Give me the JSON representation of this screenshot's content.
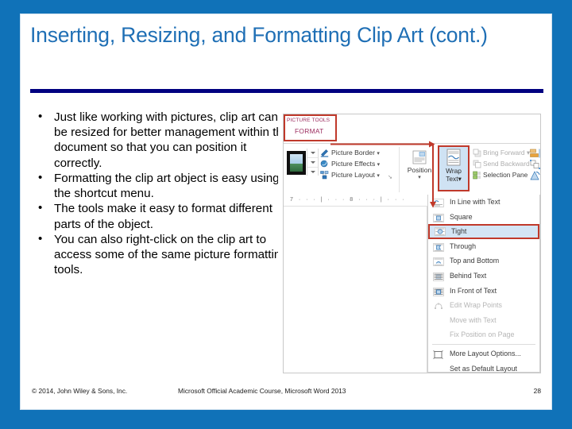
{
  "slide": {
    "title": "Inserting, Resizing, and Formatting Clip Art (cont.)",
    "accent_color": "#1072b8",
    "title_color": "#1f6fb5",
    "rule_color": "#000080",
    "bullets": [
      "Just like working with pictures, clip art can be resized for better management within the document so that you can position it correctly.",
      "Formatting the clip art object is easy using the shortcut menu.",
      "The tools make it easy to format different parts of the object.",
      "You can also right-click on the clip art to access some of the same picture formatting tools."
    ],
    "bullet_marker": "•"
  },
  "footer": {
    "copyright": "© 2014, John Wiley & Sons, Inc.",
    "course": "Microsoft Official Academic Course, Microsoft Word 2013",
    "page_number": "28"
  },
  "screenshot": {
    "contextual_tab": {
      "group_label": "PICTURE TOOLS",
      "tab_label": "FORMAT",
      "highlight_color": "#c0392b",
      "text_color": "#9b2b5e"
    },
    "picture_styles_group": {
      "commands": [
        {
          "label": "Picture Border",
          "icon": "picture-border-icon",
          "caret": "▾"
        },
        {
          "label": "Picture Effects",
          "icon": "picture-effects-icon",
          "caret": "▾"
        },
        {
          "label": "Picture Layout",
          "icon": "picture-layout-icon",
          "caret": "▾"
        }
      ],
      "dialog_launcher": "➘"
    },
    "arrange_group": {
      "position_label": "Position",
      "position_caret": "▾",
      "wrap_text_label_line1": "Wrap",
      "wrap_text_label_line2": "Text",
      "wrap_text_caret": "▾",
      "wrap_text_highlight": "#cfe2f3",
      "commands": [
        {
          "label": "Bring Forward",
          "icon": "bring-forward-icon",
          "caret": "▾",
          "enabled": false
        },
        {
          "label": "Send Backward",
          "icon": "send-backward-icon",
          "caret": "▾",
          "enabled": false
        },
        {
          "label": "Selection Pane",
          "icon": "selection-pane-icon",
          "caret": "",
          "enabled": true
        }
      ],
      "align_icons": [
        "align-objects-icon",
        "group-objects-icon",
        "rotate-objects-icon"
      ]
    },
    "ruler": {
      "marks": "7   ·   ·   ·   |   ·   ·   ·   8   ·   ·   ·   |   ·   ·   ·"
    },
    "wrap_menu": {
      "selected_item": "Tight",
      "selection_color": "#d4e5f5",
      "selection_border": "#c0392b",
      "items": [
        {
          "label": "In Line with Text",
          "icon": "wrap-inline-icon",
          "enabled": true,
          "selected": false
        },
        {
          "label": "Square",
          "icon": "wrap-square-icon",
          "enabled": true,
          "selected": false
        },
        {
          "label": "Tight",
          "icon": "wrap-tight-icon",
          "enabled": true,
          "selected": true
        },
        {
          "label": "Through",
          "icon": "wrap-through-icon",
          "enabled": true,
          "selected": false
        },
        {
          "label": "Top and Bottom",
          "icon": "wrap-top-bottom-icon",
          "enabled": true,
          "selected": false
        },
        {
          "label": "Behind Text",
          "icon": "wrap-behind-text-icon",
          "enabled": true,
          "selected": false
        },
        {
          "label": "In Front of Text",
          "icon": "wrap-in-front-icon",
          "enabled": true,
          "selected": false
        },
        {
          "label": "Edit Wrap Points",
          "icon": "edit-wrap-points-icon",
          "enabled": false,
          "selected": false
        },
        {
          "label": "Move with Text",
          "icon": "",
          "enabled": false,
          "selected": false
        },
        {
          "label": "Fix Position on Page",
          "icon": "",
          "enabled": false,
          "selected": false
        },
        {
          "label": "More Layout Options...",
          "icon": "more-layout-options-icon",
          "enabled": true,
          "selected": false
        },
        {
          "label": "Set as Default Layout",
          "icon": "",
          "enabled": true,
          "selected": false
        }
      ]
    },
    "annotations": {
      "arrow_color": "#c0392b",
      "horizontal_arrow": "points-right-to-wrap-text",
      "vertical_arrow": "points-down-to-menu",
      "cursor": "mouse-pointer-on-tight"
    }
  }
}
